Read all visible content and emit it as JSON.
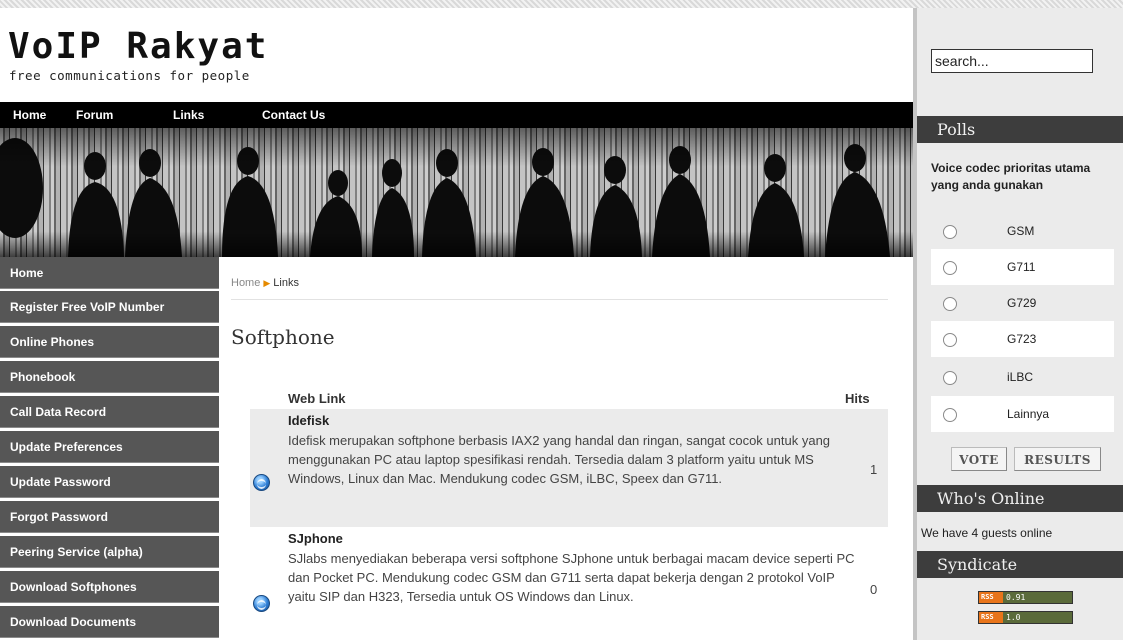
{
  "header": {
    "logo_title": "VoIP Rakyat",
    "tagline": "free communications for people"
  },
  "topnav": [
    "Home",
    "Forum",
    "Links",
    "Contact Us"
  ],
  "leftmenu": [
    "Home",
    "Register Free VoIP Number",
    "Online Phones",
    "Phonebook",
    "Call Data Record",
    "Update Preferences",
    "Update Password",
    "Forgot Password",
    "Peering Service (alpha)",
    "Download Softphones",
    "Download Documents"
  ],
  "breadcrumb": {
    "home": "Home",
    "current": "Links"
  },
  "page_title": "Softphone",
  "table": {
    "col_weblink": "Web Link",
    "col_hits": "Hits",
    "rows": [
      {
        "name": "Idefisk",
        "description": "Idefisk merupakan softphone berbasis IAX2 yang handal dan ringan, sangat cocok untuk yang menggunakan PC atau laptop spesifikasi rendah. Tersedia dalam 3 platform yaitu untuk MS Windows, Linux dan Mac. Mendukung codec GSM, iLBC, Speex dan G711.",
        "hits": "1",
        "icon": "globe-icon"
      },
      {
        "name": "SJphone",
        "description": "SJlabs menyediakan beberapa versi softphone SJphone untuk berbagai macam device seperti PC dan Pocket PC. Mendukung codec GSM dan G711 serta dapat bekerja dengan 2 protokol VoIP yaitu SIP dan H323, Tersedia untuk OS Windows dan Linux.",
        "hits": "0",
        "icon": "globe-icon"
      }
    ]
  },
  "sidebar": {
    "search_value": "search...",
    "polls_title": "Polls",
    "poll_question": "Voice codec prioritas utama yang anda gunakan",
    "poll_options": [
      "GSM",
      "G711",
      "G729",
      "G723",
      "iLBC",
      "Lainnya"
    ],
    "vote_label": "VOTE",
    "results_label": "RESULTS",
    "online_title": "Who's Online",
    "online_text": "We have 4 guests online",
    "syndicate_title": "Syndicate",
    "feeds": [
      {
        "tag": "RSS",
        "version": "0.91"
      },
      {
        "tag": "RSS",
        "version": "1.0"
      }
    ]
  },
  "colors": {
    "menu_bg": "#565656",
    "topnav_bg": "#000000",
    "module_header_bg": "#3d3d3d",
    "breadcrumb_arrow": "#e58a00",
    "rss_orange": "#e8741a"
  }
}
